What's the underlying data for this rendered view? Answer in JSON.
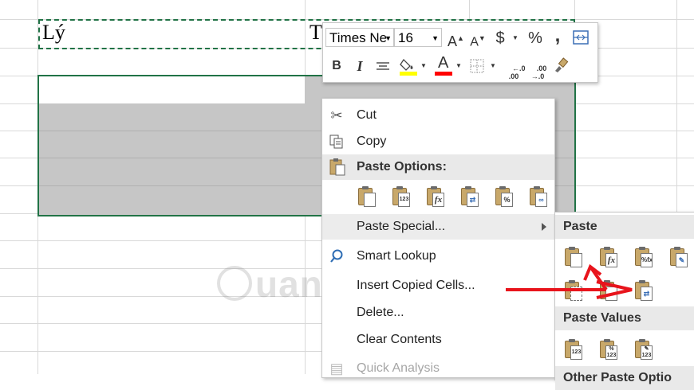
{
  "sheet": {
    "cell_a1": "Lý",
    "cell_b1": "T"
  },
  "mini_toolbar": {
    "font_name": "Times Ne",
    "font_size": "16",
    "increase_font": "A",
    "decrease_font": "A",
    "currency": "$",
    "percent": "%",
    "comma": ",",
    "bold": "B",
    "italic": "I",
    "font_color": "A",
    "inc_decimal": "←.0\n.00",
    "dec_decimal": ".00\n→.0",
    "highlight_color": "#ffff00",
    "font_color_value": "#ff0000"
  },
  "context_menu": {
    "cut": "Cut",
    "copy": "Copy",
    "paste_options": "Paste Options:",
    "paste_special": "Paste Special...",
    "smart_lookup": "Smart Lookup",
    "insert_copied": "Insert Copied Cells...",
    "delete": "Delete...",
    "clear_contents": "Clear Contents",
    "quick_analysis": "Quick Analysis"
  },
  "submenu": {
    "paste": "Paste",
    "paste_values": "Paste Values",
    "other_paste": "Other Paste Optio"
  },
  "paste_icons": {
    "values": "123",
    "formula": "fx",
    "percent": "%"
  },
  "colors": {
    "accent_green": "#217346",
    "arrow_red": "#e8141c"
  },
  "watermark": "uantrimang"
}
